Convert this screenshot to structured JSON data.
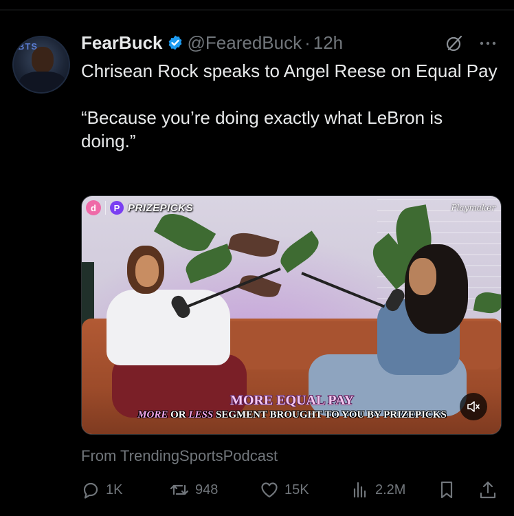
{
  "tweet": {
    "author": {
      "display_name": "FearBuck",
      "handle": "@FearedBuck",
      "separator": "·",
      "time": "12h",
      "avatar_icon": "avatar-photo"
    },
    "text": "Chrisean Rock speaks to Angel Reese on Equal Pay\n\n“Because you’re doing exactly what LeBron is doing.”",
    "media": {
      "brand_logo_letter": "d",
      "sponsor_logo_letter": "P",
      "sponsor_label": "PRIZEPICKS",
      "watermark": "Playmaker",
      "caption_title": "MORE EQUAL PAY",
      "caption_part1": "MORE",
      "caption_part2": " OR ",
      "caption_part3": "LESS",
      "caption_part4": " SEGMENT BROUGHT TO YOU BY PRIZEPICKS",
      "mute_icon": "speaker-muted-icon"
    },
    "source": "From TrendingSportsPodcast",
    "actions": {
      "replies": "1K",
      "reposts": "948",
      "likes": "15K",
      "views": "2.2M"
    }
  },
  "colors": {
    "background": "#000000",
    "text_primary": "#e7e9ea",
    "text_secondary": "#71767b",
    "verified": "#1d9bf0",
    "prizepicks": "#7a3ff2"
  }
}
